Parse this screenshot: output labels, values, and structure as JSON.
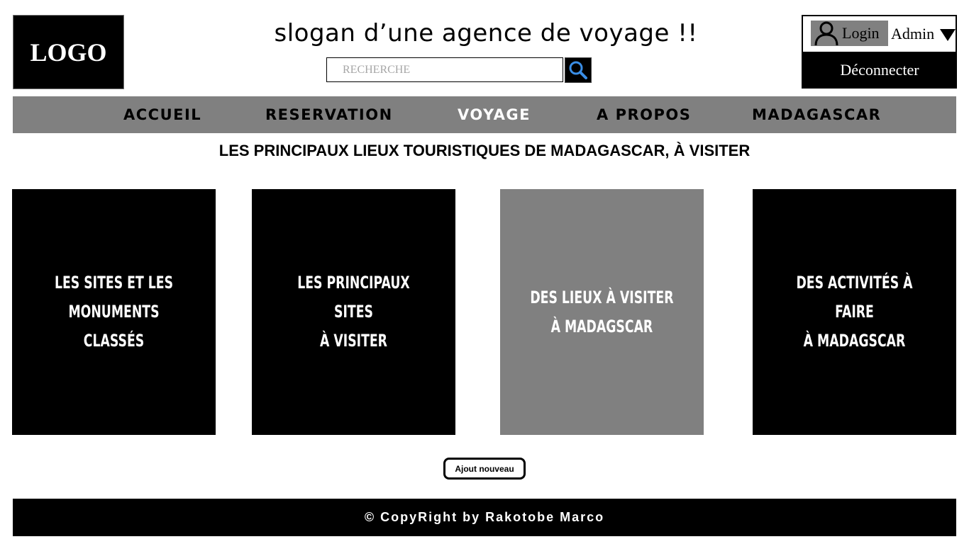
{
  "header": {
    "logo_text": "LOGO",
    "slogan": "slogan d’une agence de voyage !!",
    "search": {
      "placeholder": "RECHERCHE",
      "value": "",
      "button_icon": "search-icon"
    },
    "account": {
      "login_label": "Login",
      "user_icon": "user-icon",
      "admin_label": "Admin",
      "dropdown_icon": "caret-down-icon",
      "logout_label": "Déconnecter"
    }
  },
  "nav": {
    "items": [
      {
        "label": "ACCUEIL",
        "active": false
      },
      {
        "label": "RESERVATION",
        "active": false
      },
      {
        "label": "VOYAGE",
        "active": true
      },
      {
        "label": "A PROPOS",
        "active": false
      },
      {
        "label": "MADAGASCAR",
        "active": false
      }
    ]
  },
  "main": {
    "title": "LES PRINCIPAUX LIEUX TOURISTIQUES DE MADAGASCAR, À VISITER",
    "cards": [
      {
        "label": "LES SITES ET LES MONUMENTS\nCLASSÉS",
        "color": "#000000"
      },
      {
        "label": "LES PRINCIPAUX SITES\nÀ VISITER",
        "color": "#000000"
      },
      {
        "label": "DES LIEUX À VISITER\nÀ MADAGSCAR",
        "color": "#808080"
      },
      {
        "label": "DES ACTIVITÉS À FAIRE\nÀ MADAGSCAR",
        "color": "#000000"
      }
    ],
    "add_button_label": "Ajout nouveau"
  },
  "footer": {
    "text": "© CopyRight by Rakotobe Marco"
  },
  "colors": {
    "nav_bg": "#808080",
    "active_nav": "#ffffff",
    "dark": "#000000"
  }
}
